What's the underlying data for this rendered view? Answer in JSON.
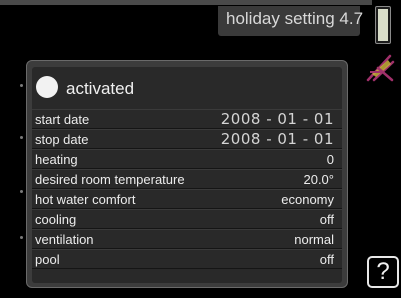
{
  "header": {
    "title": "holiday setting 4.7"
  },
  "icons": {
    "holiday": "deck-chair-icon",
    "scroll": "scroll-indicator",
    "help": "help-icon"
  },
  "help": {
    "label": "?"
  },
  "activated": {
    "label": "activated",
    "checked": false
  },
  "settings": [
    {
      "label": "start date",
      "value": "2008 - 01 - 01"
    },
    {
      "label": "stop date",
      "value": "2008 - 01 - 01"
    },
    {
      "label": "heating",
      "value": "0"
    },
    {
      "label": "desired room temperature",
      "value": "20.0°"
    },
    {
      "label": "hot water comfort",
      "value": "economy"
    },
    {
      "label": "cooling",
      "value": "off"
    },
    {
      "label": "ventilation",
      "value": "normal"
    },
    {
      "label": "pool",
      "value": "off"
    }
  ],
  "colors": {
    "background": "#000000",
    "panel": "#3c3c3c",
    "panel_inner": "#292929",
    "text": "#ececec",
    "chair_frame": "#a0306a",
    "chair_seat": "#c8b23a"
  }
}
